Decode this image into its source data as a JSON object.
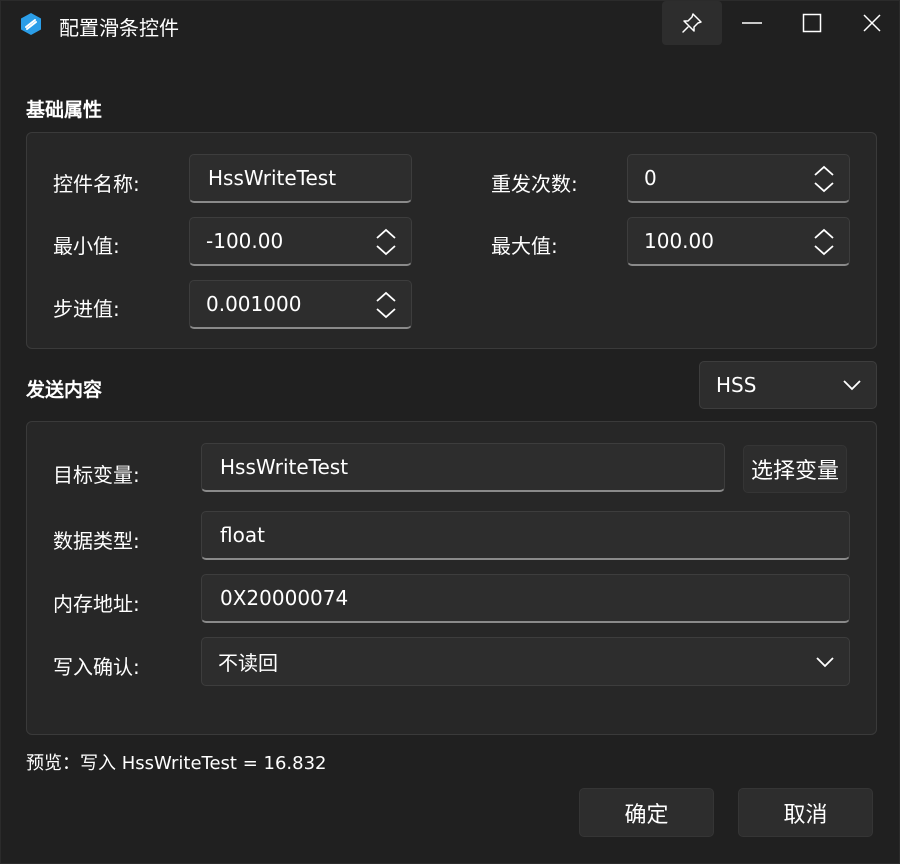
{
  "window": {
    "title": "配置滑条控件",
    "accent": "#2b9ee8"
  },
  "basic": {
    "section_title": "基础属性",
    "name_label": "控件名称:",
    "name_value": "HssWriteTest",
    "repeat_label": "重发次数:",
    "repeat_value": "0",
    "min_label": "最小值:",
    "min_value": "-100.00",
    "max_label": "最大值:",
    "max_value": "100.00",
    "step_label": "步进值:",
    "step_value": "0.001000"
  },
  "send": {
    "section_title": "发送内容",
    "protocol_value": "HSS",
    "target_label": "目标变量:",
    "target_value": "HssWriteTest",
    "select_button": "选择变量",
    "type_label": "数据类型:",
    "type_value": "float",
    "address_label": "内存地址:",
    "address_value": "0X20000074",
    "confirm_label": "写入确认:",
    "confirm_value": "不读回"
  },
  "preview": {
    "text": "预览：写入 HssWriteTest = 16.832"
  },
  "footer": {
    "ok_label": "确定",
    "cancel_label": "取消"
  }
}
